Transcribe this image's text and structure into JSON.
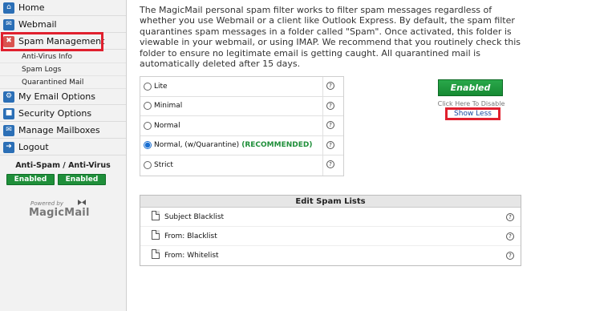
{
  "sidebar": {
    "items": [
      {
        "label": "Home",
        "icon": "home-icon"
      },
      {
        "label": "Webmail",
        "icon": "mail-icon"
      },
      {
        "label": "Spam Management",
        "icon": "spam-icon"
      }
    ],
    "sub_items": [
      "Anti-Virus Info",
      "Spam Logs",
      "Quarantined Mail"
    ],
    "items2": [
      {
        "label": "My Email Options",
        "icon": "gear-icon"
      },
      {
        "label": "Security Options",
        "icon": "lock-icon"
      },
      {
        "label": "Manage Mailboxes",
        "icon": "mailbox-icon"
      },
      {
        "label": "Logout",
        "icon": "logout-icon"
      }
    ],
    "antispam_title": "Anti-Spam / Anti-Virus",
    "antispam_enabled": "Enabled",
    "antivirus_enabled": "Enabled",
    "powered_by": "Powered by",
    "brand": "MagicMail"
  },
  "intro": "The MagicMail personal spam filter works to filter spam messages regardless of whether you use Webmail or a client like Outlook Express. By default, the spam filter quarantines spam messages in a folder called \"Spam\". Once activated, this folder is viewable in your webmail, or using IMAP. We recommend that you routinely check this folder to ensure no legitimate email is getting caught. All quarantined mail is automatically deleted after 15 days.",
  "options": [
    {
      "label": "Lite",
      "selected": false,
      "rec": ""
    },
    {
      "label": "Minimal",
      "selected": false,
      "rec": ""
    },
    {
      "label": "Normal",
      "selected": false,
      "rec": ""
    },
    {
      "label": "Normal, (w/Quarantine)",
      "selected": true,
      "rec": "(RECOMMENDED)"
    },
    {
      "label": "Strict",
      "selected": false,
      "rec": ""
    }
  ],
  "help_glyph": "?",
  "status": {
    "enabled": "Enabled",
    "click_to_disable": "Click Here To Disable",
    "show_less": "Show Less"
  },
  "spam_lists": {
    "title": "Edit Spam Lists",
    "rows": [
      "Subject Blacklist",
      "From: Blacklist",
      "From: Whitelist"
    ]
  },
  "colors": {
    "accent_red": "#e0202e",
    "enabled_green": "#1f8f3a",
    "nav_icon_blue": "#2b6fb6"
  }
}
